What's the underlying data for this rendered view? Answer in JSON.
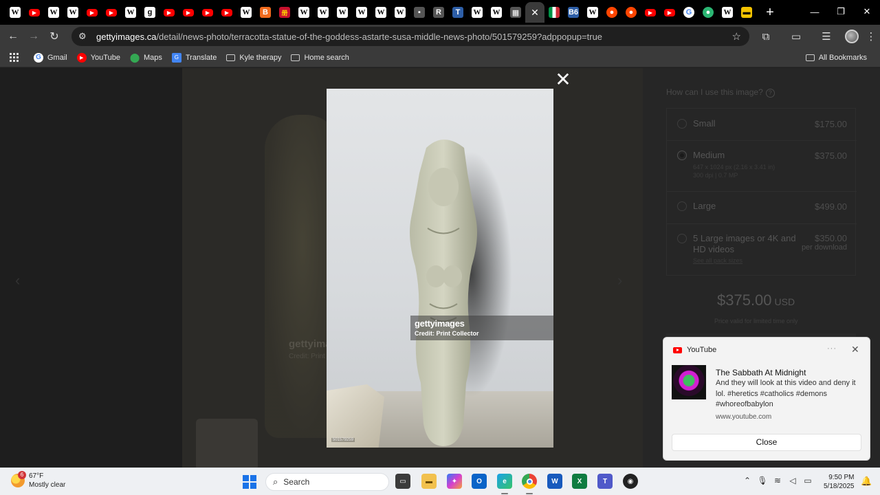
{
  "browser": {
    "url_domain": "gettyimages.ca",
    "url_path": "/detail/news-photo/terracotta-statue-of-the-goddess-astarte-susa-middle-news-photo/501579259?adppopup=true",
    "tabs": [
      {
        "icon": "wikipedia-icon",
        "label": "W"
      },
      {
        "icon": "youtube-icon",
        "label": "▶"
      },
      {
        "icon": "wikipedia-icon",
        "label": "W"
      },
      {
        "icon": "wikipedia-icon",
        "label": "W"
      },
      {
        "icon": "youtube-icon",
        "label": "▶"
      },
      {
        "icon": "youtube-icon",
        "label": "▶"
      },
      {
        "icon": "wikipedia-icon",
        "label": "W"
      },
      {
        "icon": "g-icon",
        "label": "g"
      },
      {
        "icon": "youtube-icon",
        "label": "▶"
      },
      {
        "icon": "youtube-icon",
        "label": "▶"
      },
      {
        "icon": "youtube-icon",
        "label": "▶"
      },
      {
        "icon": "youtube-icon",
        "label": "▶"
      },
      {
        "icon": "wikipedia-icon",
        "label": "W"
      },
      {
        "icon": "blogger-icon",
        "label": "B"
      },
      {
        "icon": "red-square-icon",
        "label": "册"
      },
      {
        "icon": "wikipedia-icon",
        "label": "W"
      },
      {
        "icon": "wikipedia-icon",
        "label": "W"
      },
      {
        "icon": "wikipedia-icon",
        "label": "W"
      },
      {
        "icon": "wikipedia-icon",
        "label": "W"
      },
      {
        "icon": "wikipedia-icon",
        "label": "W"
      },
      {
        "icon": "wikipedia-icon",
        "label": "W"
      },
      {
        "icon": "dark-site-icon",
        "label": "▪"
      },
      {
        "icon": "r-site-icon",
        "label": "R"
      },
      {
        "icon": "t-site-icon",
        "label": "T"
      },
      {
        "icon": "wikipedia-icon",
        "label": "W"
      },
      {
        "icon": "wikipedia-icon",
        "label": "W"
      },
      {
        "icon": "image-site-icon",
        "label": "▦"
      }
    ],
    "active_tab_close": "✕",
    "tabs_after": [
      {
        "icon": "italy-flag-icon",
        "label": ""
      },
      {
        "icon": "b6-site-icon",
        "label": "B6"
      },
      {
        "icon": "wikipedia-icon",
        "label": "W"
      },
      {
        "icon": "reddit-icon",
        "label": "●"
      },
      {
        "icon": "reddit-icon",
        "label": "●"
      },
      {
        "icon": "youtube-icon",
        "label": "▶"
      },
      {
        "icon": "youtube-icon",
        "label": "▶"
      },
      {
        "icon": "google-icon",
        "label": "G"
      },
      {
        "icon": "green-globe-icon",
        "label": "●"
      },
      {
        "icon": "wikipedia-icon",
        "label": "W"
      },
      {
        "icon": "yellow-site-icon",
        "label": "▬"
      }
    ],
    "new_tab": "+",
    "bookmarks": [
      {
        "icon": "gmail-icon",
        "label": "Gmail"
      },
      {
        "icon": "youtube-icon",
        "label": "YouTube"
      },
      {
        "icon": "maps-icon",
        "label": "Maps"
      },
      {
        "icon": "translate-icon",
        "label": "Translate"
      },
      {
        "icon": "folder-icon",
        "label": "Kyle therapy"
      },
      {
        "icon": "folder-icon",
        "label": "Home search"
      }
    ],
    "all_bookmarks": "All Bookmarks"
  },
  "lightbox": {
    "watermark_logo": "gettyimages",
    "watermark_credit": "Credit: Print Collector",
    "image_id": "501579259"
  },
  "purchase": {
    "usage_question": "How can I use this image?",
    "sizes": [
      {
        "name": "Small",
        "price": "$175.00"
      },
      {
        "name": "Medium",
        "price": "$375.00",
        "detail1": "647 x 1024 px (2.16 x 3.41 in)",
        "detail2": "300 dpi | 0.7 MP"
      },
      {
        "name": "Large",
        "price": "$499.00"
      },
      {
        "name": "5 Large images or 4K and HD videos",
        "price": "$350.00",
        "price_note": "per download",
        "link": "See all pack sizes"
      }
    ],
    "selected_size": "Medium",
    "total": "$375.00",
    "currency": "USD",
    "price_note": "Price valid for limited time only"
  },
  "notification": {
    "app": "YouTube",
    "more": "···",
    "title": "The Sabbath At Midnight",
    "body": "And they will look at this video and deny it lol. #heretics #catholics #demons #whoreofbabylon",
    "source": "www.youtube.com",
    "close_button": "Close"
  },
  "taskbar": {
    "weather_temp": "67°F",
    "weather_desc": "Mostly clear",
    "weather_badge": "6",
    "search_placeholder": "Search",
    "time": "9:50 PM",
    "date": "5/18/2025"
  }
}
